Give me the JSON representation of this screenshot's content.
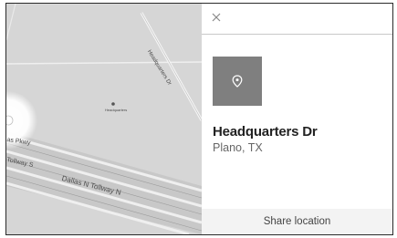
{
  "map": {
    "road_labels": {
      "headquarters": "Headquarters Dr",
      "pkwy": "as Pkwy",
      "tollway_s": "Tollway S",
      "tollway_n": "Dallas N Tollway N"
    },
    "poi_label": "Headquarters"
  },
  "panel": {
    "close_icon": "close-icon",
    "place_icon": "location-pin-icon",
    "place_name": "Headquarters Dr",
    "place_subtitle": "Plano, TX",
    "share_label": "Share location"
  },
  "colors": {
    "map_bg": "#d6d6d6",
    "thumb_bg": "#7f7f7f",
    "share_bg": "#f3f3f3"
  }
}
